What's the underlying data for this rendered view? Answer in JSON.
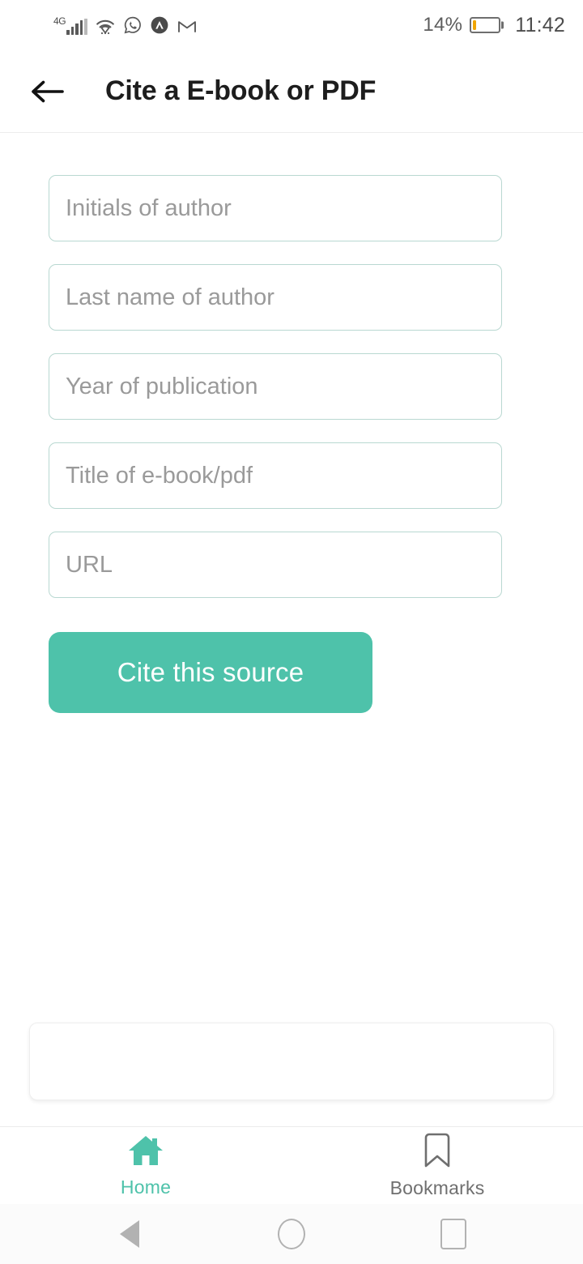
{
  "statusbar": {
    "network_label": "4G",
    "signal_icon": "signal-bars-icon",
    "wifi_icon": "wifi-icon",
    "whatsapp_icon": "whatsapp-icon",
    "app_icon": "circle-a-app-icon",
    "gmail_icon": "gmail-icon",
    "battery_percent": "14%",
    "battery_level": 14,
    "battery_icon": "battery-low-icon",
    "battery_color": "#f0a500",
    "time": "11:42"
  },
  "header": {
    "back_icon": "arrow-left-icon",
    "title": "Cite a E-book or PDF"
  },
  "form": {
    "fields": [
      {
        "name": "initials-of-author",
        "placeholder": "Initials of author",
        "value": ""
      },
      {
        "name": "last-name-of-author",
        "placeholder": "Last name of author",
        "value": ""
      },
      {
        "name": "year-of-publication",
        "placeholder": "Year of publication",
        "value": ""
      },
      {
        "name": "title-of-ebook-pdf",
        "placeholder": "Title of e-book/pdf",
        "value": ""
      },
      {
        "name": "url",
        "placeholder": "URL",
        "value": ""
      }
    ],
    "submit_label": "Cite this source",
    "accent_color": "#4ec2aa",
    "field_border_color": "#b9d8d1"
  },
  "result_card": {
    "text": ""
  },
  "bottomnav": {
    "items": [
      {
        "label": "Home",
        "icon": "home-icon",
        "active": true,
        "color": "#4ec2aa"
      },
      {
        "label": "Bookmarks",
        "icon": "bookmark-icon",
        "active": false,
        "color": "#6f6f6f"
      }
    ]
  },
  "sysnav": {
    "back_icon": "triangle-back-icon",
    "home_icon": "circle-home-icon",
    "recents_icon": "square-recents-icon"
  }
}
